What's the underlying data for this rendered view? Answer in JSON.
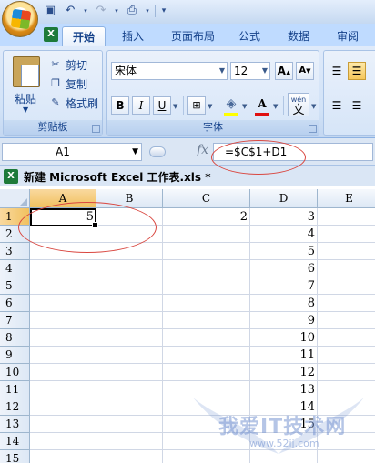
{
  "qat": {
    "icons": [
      "save-icon",
      "undo-icon",
      "redo-icon",
      "print-preview-icon",
      "customize-icon"
    ]
  },
  "tabs": [
    "开始",
    "插入",
    "页面布局",
    "公式",
    "数据",
    "审阅"
  ],
  "clipboard": {
    "paste": "粘贴",
    "cut": "剪切",
    "copy": "复制",
    "format_painter": "格式刷",
    "group_label": "剪贴板"
  },
  "font": {
    "name": "宋体",
    "size": "12",
    "grow": "A",
    "shrink": "A",
    "bold": "B",
    "italic": "I",
    "underline": "U",
    "font_color_letter": "A",
    "wen": "wén",
    "wen_char": "文",
    "group_label": "字体",
    "highlight_color": "#ffff00",
    "font_color": "#e01010"
  },
  "formula_bar": {
    "name_box": "A1",
    "fx": "fx",
    "formula": "=$C$1+D1"
  },
  "workbook": {
    "title": "新建 Microsoft Excel 工作表.xls *"
  },
  "sheet": {
    "columns": [
      "A",
      "B",
      "C",
      "D",
      "E"
    ],
    "rows": [
      "1",
      "2",
      "3",
      "4",
      "5",
      "6",
      "7",
      "8",
      "9",
      "10",
      "11",
      "12",
      "13",
      "14",
      "15"
    ],
    "cells": {
      "A1": "5",
      "C1": "2",
      "D": [
        "3",
        "4",
        "5",
        "6",
        "7",
        "8",
        "9",
        "10",
        "11",
        "12",
        "13",
        "14",
        "15"
      ]
    },
    "active_cell": "A1"
  },
  "watermark": {
    "main": "我爱IT技术网",
    "url": "www.52ij.com"
  },
  "colors": {
    "annotation": "#d9463f",
    "ribbon": "#d1e2f7",
    "selected_header": "#f1c15f"
  }
}
